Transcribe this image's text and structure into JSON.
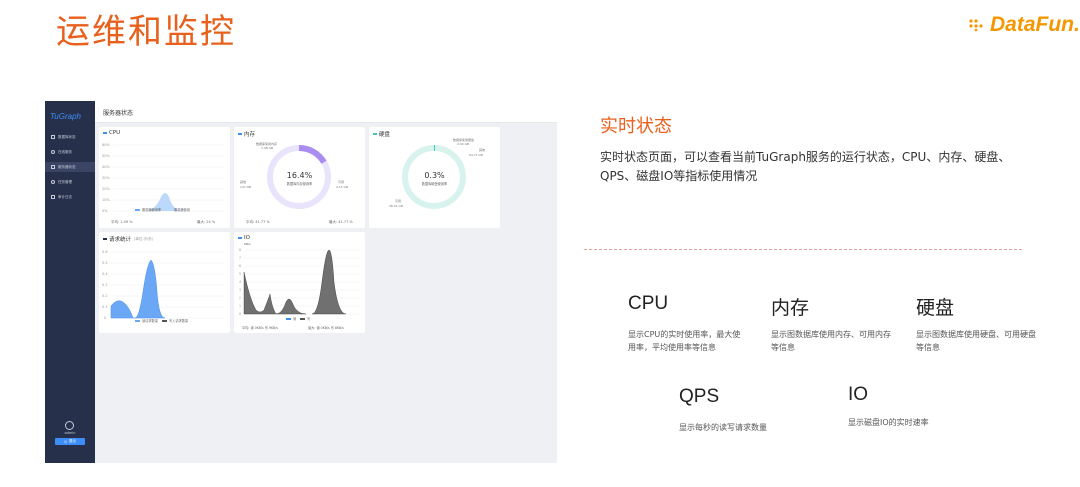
{
  "slide": {
    "title": "运维和监控"
  },
  "logo": {
    "text": "DataFun."
  },
  "app": {
    "brand": "TuGraph",
    "page_title": "服务器状态",
    "nav": [
      {
        "label": "数据库状态",
        "active": false
      },
      {
        "label": "在线服务",
        "active": false
      },
      {
        "label": "服务器状态",
        "active": true
      },
      {
        "label": "任务管理",
        "active": false
      },
      {
        "label": "审计日志",
        "active": false
      }
    ],
    "user": "admin",
    "logout": "退出",
    "cpu": {
      "title": "CPU",
      "yticks": [
        "60%",
        "50%",
        "40%",
        "30%",
        "20%",
        "10%",
        "0%"
      ],
      "legend": [
        "服务器使用率",
        "服务器使用"
      ],
      "avg": "平均: 1.09 %",
      "max": "最大: 24 %"
    },
    "memory": {
      "title": "内存",
      "percent": "16.4%",
      "center_label": "数据库内存使用率",
      "callouts": [
        "数据库使用内存",
        "1.08 GB",
        "其他",
        "147 GB",
        "可用",
        "4.15 GB"
      ],
      "avg": "平均: 41.77 %",
      "max": "最大: 41.77 %"
    },
    "disk": {
      "title": "硬盘",
      "percent": "0.3%",
      "center_label": "数据库硬盘使用率",
      "callouts": [
        "数据库使用硬盘",
        "0.00 GB",
        "其他",
        "94.71 GB",
        "可用",
        "38.51 GB"
      ]
    },
    "requests": {
      "title": "请求统计",
      "subtitle": "(单位:次/秒)",
      "yticks": [
        "0.6",
        "0.5",
        "0.4",
        "0.3",
        "0.2",
        "0.1",
        "0"
      ],
      "legend": [
        "读请求数量",
        "写入请求数量"
      ]
    },
    "io": {
      "title": "IO",
      "unit": "KB/s",
      "yticks": [
        "8",
        "7",
        "6",
        "5",
        "4",
        "3",
        "2",
        "1",
        "0"
      ],
      "legend": [
        "读",
        "写"
      ],
      "avg": "平均: 读 0KB/s 写 9KB/s",
      "max": "最大: 读 0KB/s 写 8KB/s"
    }
  },
  "panel": {
    "heading": "实时状态",
    "description": "实时状态页面，可以查看当前TuGraph服务的运行状态，CPU、内存、硬盘、QPS、磁盘IO等指标使用情况"
  },
  "features": [
    {
      "name": "CPU",
      "desc": "显示CPU的实时使用率，最大使用率，平均使用率等信息"
    },
    {
      "name": "内存",
      "desc": "显示图数据库使用内存、可用内存等信息"
    },
    {
      "name": "硬盘",
      "desc": "显示图数据库使用硬盘、可用硬盘等信息"
    },
    {
      "name": "QPS",
      "desc": "显示每秒的读写请求数量"
    },
    {
      "name": "IO",
      "desc": "显示磁盘IO的实时速率"
    }
  ]
}
